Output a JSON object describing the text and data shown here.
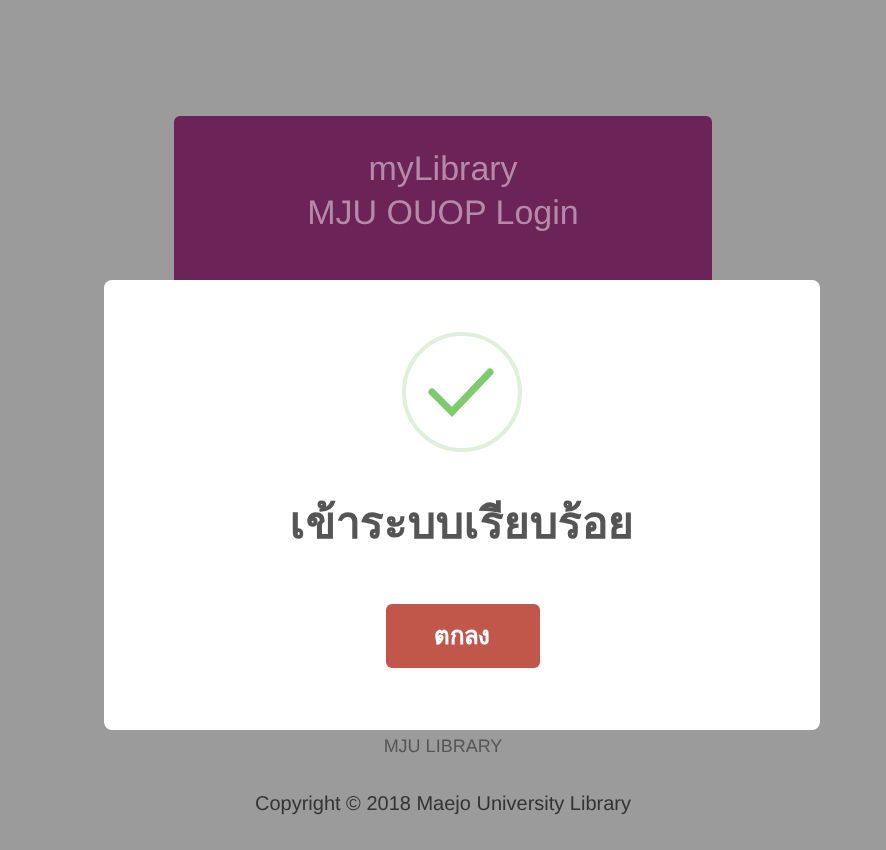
{
  "login_card": {
    "title": "myLibrary",
    "subtitle": "MJU OUOP Login"
  },
  "footer": {
    "name": "MJU LIBRARY",
    "copyright": "Copyright © 2018 Maejo University Library"
  },
  "dialog": {
    "message": "เข้าระบบเรียบร้อย",
    "button": "ตกลง"
  }
}
